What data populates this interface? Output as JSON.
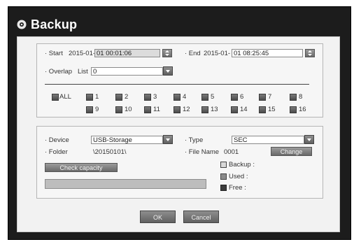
{
  "dialog": {
    "title": "Backup"
  },
  "time": {
    "start_label": "· Start",
    "start_date": "2015-01-",
    "start_value": "01 00:01:06",
    "end_label": "· End",
    "end_date": "2015-01-",
    "end_value": "01 08:25:45",
    "overlap_label": "· Overlap",
    "overlap_list_label": "List",
    "overlap_value": "0"
  },
  "channels": {
    "all_label": "ALL",
    "row1": [
      "1",
      "2",
      "3",
      "4",
      "5",
      "6",
      "7",
      "8"
    ],
    "row2": [
      "9",
      "10",
      "11",
      "12",
      "13",
      "14",
      "15",
      "16"
    ]
  },
  "device": {
    "device_label": "· Device",
    "device_value": "USB-Storage",
    "type_label": "· Type",
    "type_value": "SEC",
    "folder_label": "· Folder",
    "folder_value": "\\20150101\\",
    "filename_label": "· File Name",
    "filename_value": "0001",
    "change_button": "Change",
    "check_capacity_button": "Check capacity",
    "legend_backup": "Backup :",
    "legend_used": "Used :",
    "legend_free": "Free :"
  },
  "footer": {
    "ok": "OK",
    "cancel": "Cancel"
  }
}
